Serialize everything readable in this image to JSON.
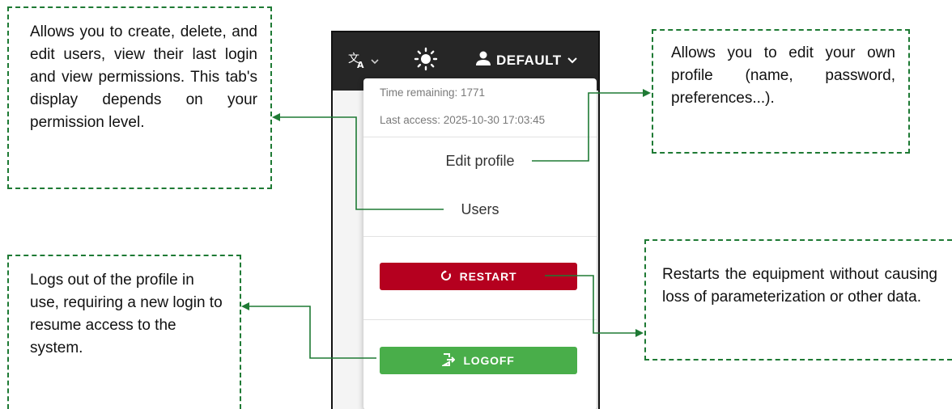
{
  "topbar": {
    "language_icon": "translate-icon",
    "theme_icon": "sun-icon",
    "user_icon": "person-icon",
    "user_name": "DEFAULT"
  },
  "dropdown": {
    "time_remaining": "Time remaining: 1771",
    "last_access": "Last access: 2025-10-30 17:03:45",
    "edit_profile": "Edit profile",
    "users": "Users",
    "restart": "RESTART",
    "logoff": "LOGOFF"
  },
  "callouts": {
    "users": "Allows you to create, delete, and edit users, view their last login and view permissions. This tab's display depends on your permission level.",
    "logoff": "Logs out of the profile in use, requiring a new login to resume access to the system.",
    "profile": "Allows you to edit your own profile (name, password, preferences...).",
    "restart": "Restarts the equipment without causing loss of parameterization or other data."
  },
  "colors": {
    "callout_border": "#1e7a34",
    "topbar": "#262626",
    "restart": "#b5001f",
    "logoff": "#49ae4a"
  }
}
